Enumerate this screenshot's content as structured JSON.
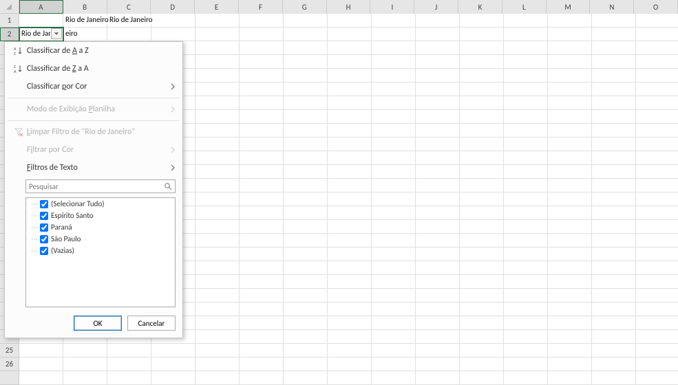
{
  "columns": [
    "A",
    "B",
    "C",
    "D",
    "E",
    "F",
    "G",
    "H",
    "I",
    "J",
    "K",
    "L",
    "M",
    "N",
    "O"
  ],
  "visible_rows_top": [
    "1",
    "2"
  ],
  "visible_rows_bottom": [
    "25",
    "26"
  ],
  "active_cell": "A2",
  "cells": {
    "B1": "Rio de Janeiro",
    "C1": "Rio de Janeiro",
    "A2": "Rio de Janeiro",
    "B2": "eiro"
  },
  "dropdown": {
    "sort_az": "Classificar de A a Z",
    "sort_az_u": "A",
    "sort_za": "Classificar de Z a A",
    "sort_za_u": "Z",
    "sort_color": "Classificar por Cor",
    "sort_color_u": "p",
    "sheet_view": "Modo de Exibição Planilha",
    "sheet_view_u": "P",
    "clear_filter": "Limpar Filtro de \"Rio de Janeiro\"",
    "clear_filter_u": "L",
    "filter_color": "Filtrar por Cor",
    "filter_color_u": "i",
    "text_filters": "Filtros de Texto",
    "text_filters_u": "F",
    "search_placeholder": "Pesquisar",
    "items": [
      {
        "label": "(Selecionar Tudo)",
        "checked": true
      },
      {
        "label": "Espírito Santo",
        "checked": true
      },
      {
        "label": "Paraná",
        "checked": true
      },
      {
        "label": "São Paulo",
        "checked": true
      },
      {
        "label": "(Vazias)",
        "checked": true
      }
    ],
    "ok": "OK",
    "cancel": "Cancelar"
  }
}
